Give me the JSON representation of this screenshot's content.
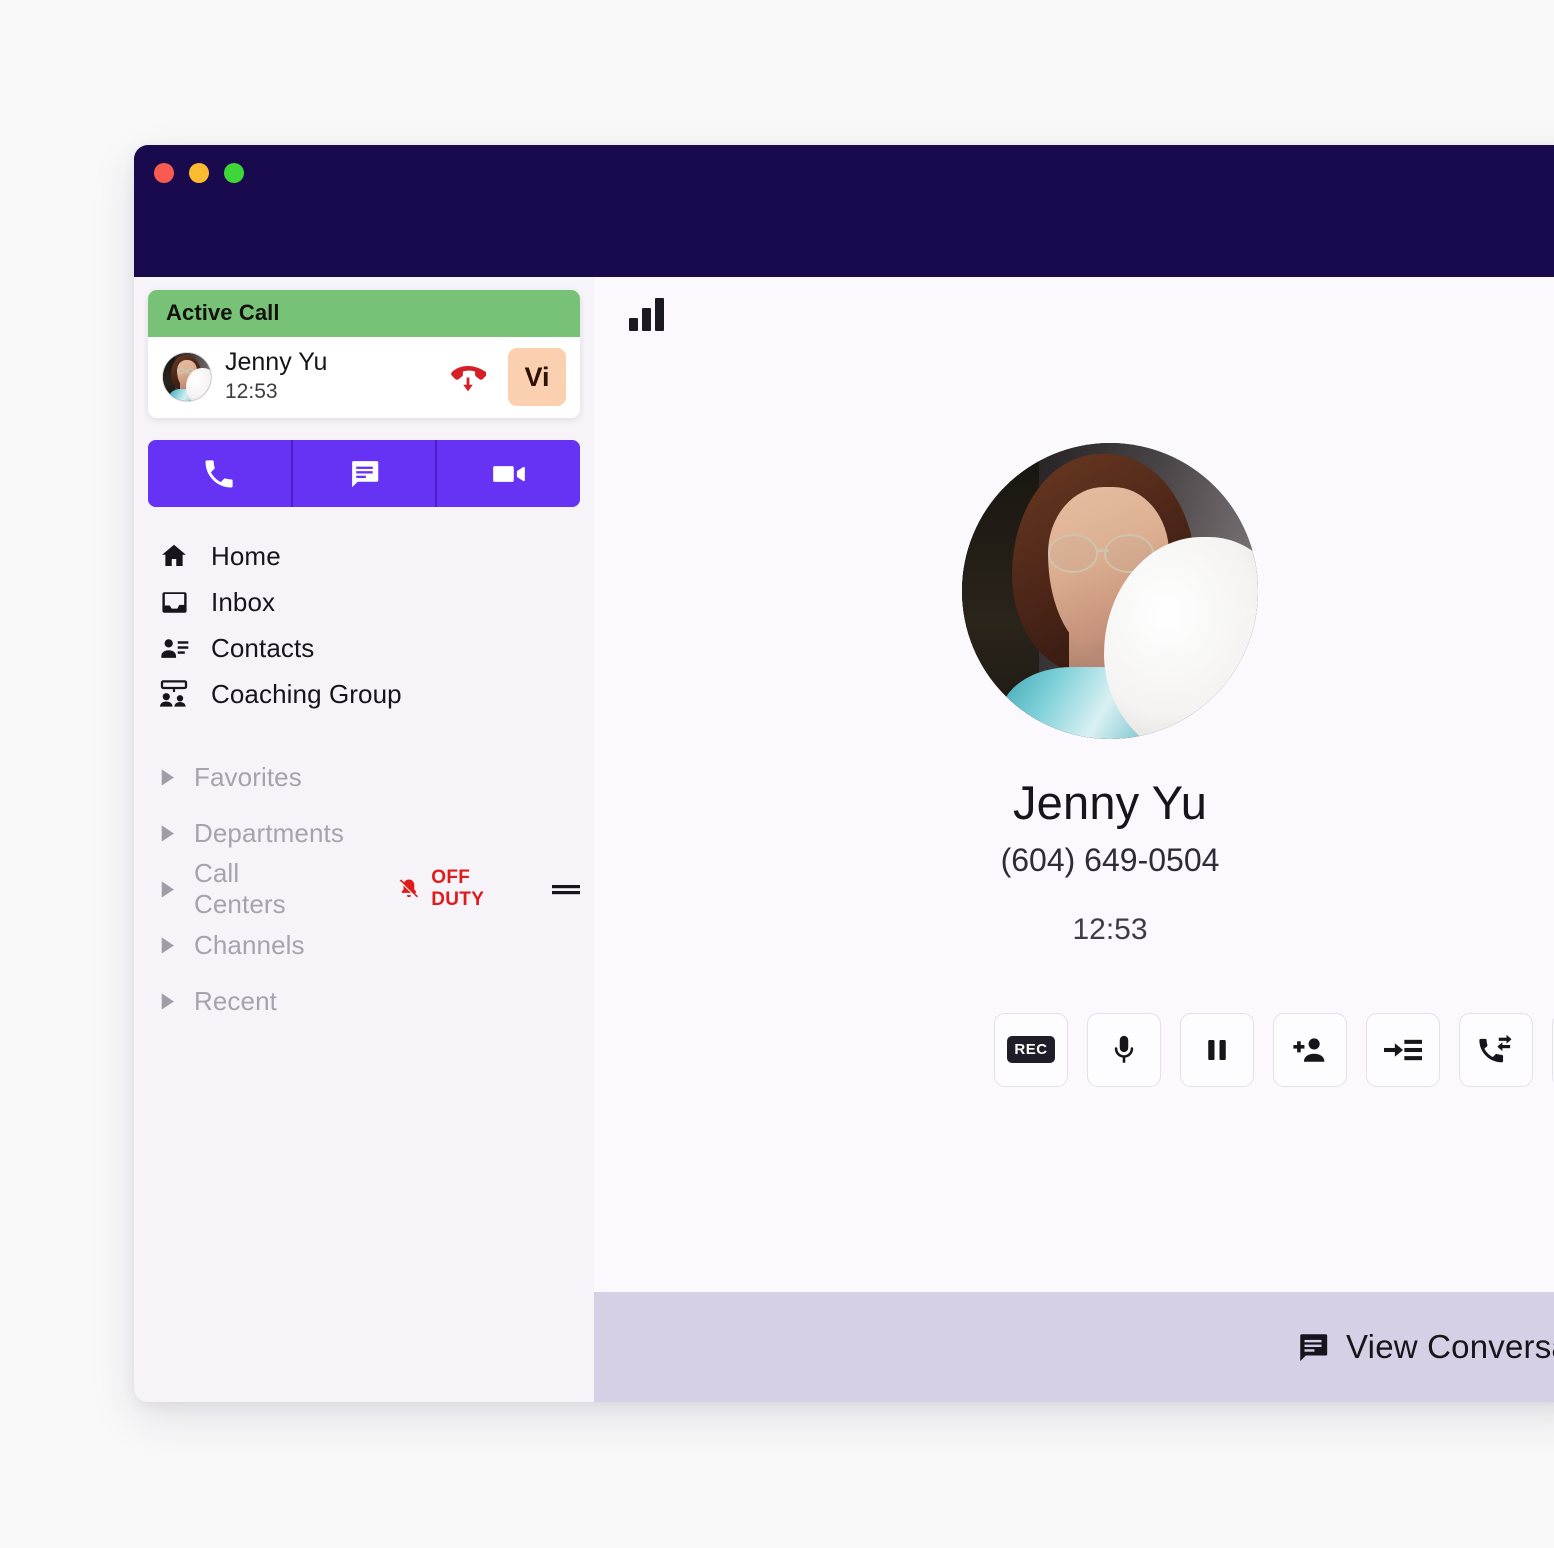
{
  "window": {
    "traffic_lights": [
      {
        "name": "close",
        "color": "#fa5b50"
      },
      {
        "name": "minimize",
        "color": "#fcbb2e"
      },
      {
        "name": "maximize",
        "color": "#3fd637"
      }
    ],
    "titlebar_color": "#190a4d"
  },
  "sidebar": {
    "active_call": {
      "header_label": "Active Call",
      "header_color": "#77c277",
      "caller_name": "Jenny Yu",
      "duration": "12:53",
      "hangup_icon": "call-end-down-icon",
      "badge_label": "Vi",
      "badge_color": "#fad0b0"
    },
    "action_buttons": [
      {
        "name": "phone-call-button",
        "icon": "phone-icon"
      },
      {
        "name": "message-button",
        "icon": "chat-bubble-icon"
      },
      {
        "name": "video-call-button",
        "icon": "video-camera-icon"
      }
    ],
    "accent_color": "#6633f5",
    "nav_items": [
      {
        "label": "Home",
        "icon": "home-icon"
      },
      {
        "label": "Inbox",
        "icon": "inbox-icon"
      },
      {
        "label": "Contacts",
        "icon": "contact-list-icon"
      },
      {
        "label": "Coaching Group",
        "icon": "coaching-group-icon"
      }
    ],
    "groups": [
      {
        "label": "Favorites",
        "expanded": false
      },
      {
        "label": "Departments",
        "expanded": false
      },
      {
        "label": "Call Centers",
        "expanded": false,
        "status_badge": "OFF DUTY",
        "status_color": "#e01b1b",
        "status_icon": "bell-off-icon",
        "handle_icon": "drag-handle-icon"
      },
      {
        "label": "Channels",
        "expanded": false
      },
      {
        "label": "Recent",
        "expanded": false
      }
    ]
  },
  "main": {
    "signal_icon": "signal-bars-icon",
    "signal_bars": 3,
    "caller": {
      "name": "Jenny Yu",
      "phone": "(604) 649-0504",
      "timer": "12:53",
      "avatar": "caller-avatar"
    },
    "controls": [
      {
        "name": "record-button",
        "icon": "rec-icon",
        "label": "REC"
      },
      {
        "name": "mute-button",
        "icon": "microphone-icon"
      },
      {
        "name": "hold-button",
        "icon": "pause-icon"
      },
      {
        "name": "add-participant-button",
        "icon": "person-add-icon"
      },
      {
        "name": "transfer-button",
        "icon": "arrow-to-list-icon"
      },
      {
        "name": "call-swap-button",
        "icon": "phone-transfer-icon"
      },
      {
        "name": "more-button",
        "icon": "more-icon"
      }
    ],
    "conversation_bar": {
      "label": "View Conversation",
      "icon": "chat-bubble-icon",
      "background": "#d5d0e5"
    }
  }
}
